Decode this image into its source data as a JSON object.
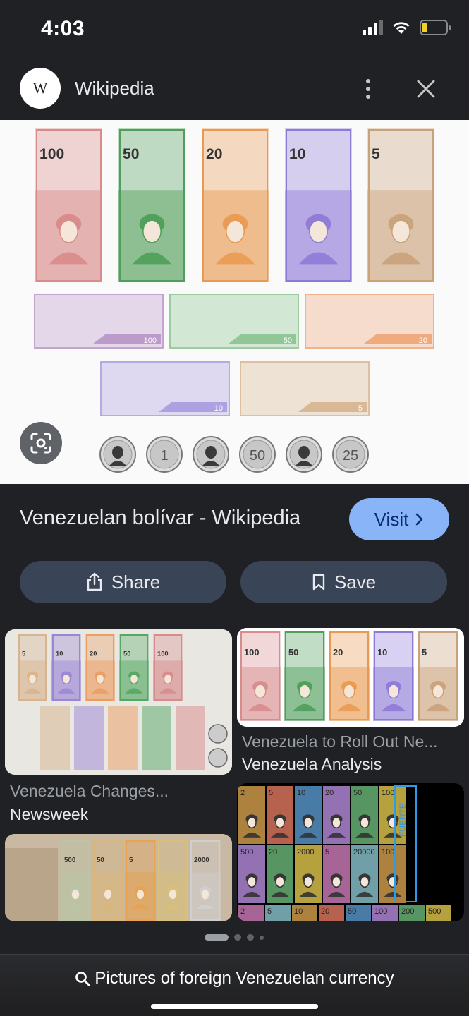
{
  "status_bar": {
    "time": "4:03",
    "battery_level": 0.2
  },
  "header": {
    "site_name": "Wikipedia",
    "logo_text": "W",
    "icons": [
      "more-vert-icon",
      "close-icon"
    ]
  },
  "hero": {
    "notes_vertical": [
      {
        "value": "100",
        "color": "#d98a8a"
      },
      {
        "value": "50",
        "color": "#4f9e5a"
      },
      {
        "value": "20",
        "color": "#e99a52"
      },
      {
        "value": "10",
        "color": "#8f7ad6"
      },
      {
        "value": "5",
        "color": "#c9a27a"
      }
    ],
    "notes_horizontal": [
      {
        "value": "100",
        "color": "#b795c8"
      },
      {
        "value": "50",
        "color": "#89c28f"
      },
      {
        "value": "20",
        "color": "#eea476"
      },
      {
        "value": "10",
        "color": "#a99ae0"
      },
      {
        "value": "5",
        "color": "#d6b48e"
      }
    ],
    "coins": [
      {
        "label": "",
        "kind": "portrait"
      },
      {
        "label": "1",
        "kind": "number"
      },
      {
        "label": "",
        "kind": "portrait"
      },
      {
        "label": "50",
        "kind": "number"
      },
      {
        "label": "",
        "kind": "portrait"
      },
      {
        "label": "25",
        "kind": "number"
      }
    ]
  },
  "result": {
    "title": "Venezuelan bolívar - Wikipedia",
    "visit_label": "Visit",
    "share_label": "Share",
    "save_label": "Save"
  },
  "related": [
    {
      "caption": "Venezuela Changes...",
      "source": "Newsweek"
    },
    {
      "caption": "Venezuela to Roll Out Ne...",
      "source": "Venezuela Analysis"
    },
    {
      "caption": "",
      "source": ""
    },
    {
      "caption": "",
      "source": ""
    }
  ],
  "thumb1": {
    "notes": [
      "5",
      "10",
      "20",
      "50",
      "100"
    ]
  },
  "thumb2": {
    "notes": [
      "100",
      "50",
      "20",
      "10",
      "5"
    ]
  },
  "thumb3": {
    "notes": [
      "500",
      "50",
      "5",
      "",
      "2000"
    ]
  },
  "thumb4": {
    "rows": [
      [
        "2",
        "5",
        "10",
        "20",
        "50",
        "100"
      ],
      [
        "500",
        "20",
        "2000",
        "5",
        "20000",
        "100"
      ],
      [
        "2",
        "5",
        "10",
        "20",
        "50",
        "100",
        "200",
        "500"
      ]
    ],
    "side_label": "FUERTE"
  },
  "pager": {
    "count": 4,
    "active": 0
  },
  "search": {
    "query": "Pictures of foreign Venezuelan currency"
  },
  "colors": {
    "accent": "#8ab4f8",
    "pill_bg": "#394457",
    "background": "#202124"
  }
}
